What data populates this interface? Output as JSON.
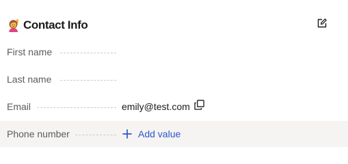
{
  "header": {
    "title": "Contact Info",
    "emoji_icon": "person-raising-hand-icon",
    "edit_icon": "edit-icon"
  },
  "fields": [
    {
      "label": "First name",
      "value": ""
    },
    {
      "label": "Last name",
      "value": ""
    },
    {
      "label": "Email",
      "value": "emily@test.com",
      "action_icon": "copy-icon"
    },
    {
      "label": "Phone number",
      "value": "",
      "add_label": "Add value",
      "add_icon": "plus-icon"
    }
  ],
  "colors": {
    "accent": "#2d56c9",
    "label": "#5c5c5c",
    "text": "#1a1a1a",
    "row_highlight": "#f5f4f2",
    "dotted_leader": "#c9c9c9"
  }
}
